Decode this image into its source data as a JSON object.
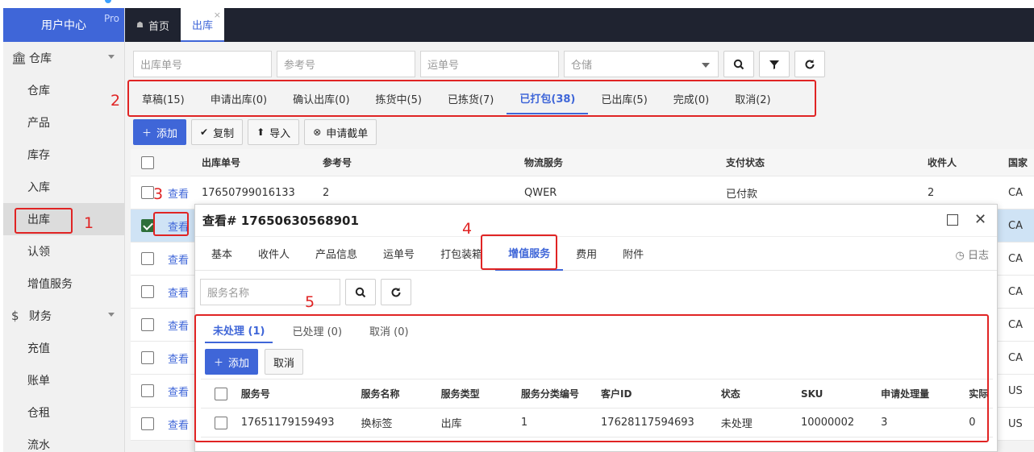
{
  "brand": {
    "title": "用户中心",
    "badge": "Pro"
  },
  "sidebar": {
    "groups": [
      {
        "label": "仓库",
        "icon": "bank-icon",
        "items": [
          "仓库",
          "产品",
          "库存",
          "入库",
          "出库",
          "认领",
          "增值服务"
        ]
      },
      {
        "label": "财务",
        "icon": "dollar-icon",
        "items": [
          "充值",
          "账单",
          "仓租",
          "流水"
        ]
      }
    ],
    "active_item": "出库"
  },
  "page_tabs": [
    {
      "label": "首页",
      "icon": "home-icon"
    },
    {
      "label": "出库",
      "active": true,
      "close": "×"
    }
  ],
  "filters": {
    "outbound_no": "出库单号",
    "reference_no": "参考号",
    "tracking_no": "运单号",
    "warehouse": "仓储",
    "search_icon": "search-icon",
    "filter_icon": "filter-icon",
    "refresh_icon": "refresh-icon"
  },
  "status_tabs": [
    "草稿(15)",
    "申请出库(0)",
    "确认出库(0)",
    "拣货中(5)",
    "已拣货(7)",
    "已打包(38)",
    "已出库(5)",
    "完成(0)",
    "取消(2)"
  ],
  "active_status_tab": "已打包(38)",
  "actions": {
    "add": "添加",
    "copy": "复制",
    "import": "导入",
    "intercept": "申请截单"
  },
  "table": {
    "headers": [
      "出库单号",
      "参考号",
      "物流服务",
      "支付状态",
      "收件人",
      "国家"
    ],
    "view_label": "查看",
    "rows": [
      {
        "no": "17650799016133",
        "ref": "2",
        "logistics": "QWER",
        "pay": "已付款",
        "recipient": "2",
        "country": "CA"
      },
      {
        "country": "CA",
        "selected": true
      },
      {
        "country": "CA"
      },
      {
        "country": "CA"
      },
      {
        "country": "CA"
      },
      {
        "country": "CA"
      },
      {
        "country": "US"
      },
      {
        "country": "US"
      }
    ]
  },
  "modal": {
    "title": "查看# 17650630568901",
    "tabs": [
      "基本",
      "收件人",
      "产品信息",
      "运单号",
      "打包装箱",
      "增值服务",
      "费用",
      "附件"
    ],
    "active_tab": "增值服务",
    "log_label": "日志",
    "search_placeholder": "服务名称",
    "sub_tabs": [
      "未处理 (1)",
      "已处理 (0)",
      "取消 (0)"
    ],
    "active_sub_tab": "未处理 (1)",
    "add_label": "添加",
    "cancel_label": "取消",
    "service_table": {
      "headers": [
        "服务号",
        "服务名称",
        "服务类型",
        "服务分类编号",
        "客户ID",
        "状态",
        "SKU",
        "申请处理量",
        "实际"
      ],
      "rows": [
        {
          "service_no": "17651179159493",
          "name": "换标签",
          "type": "出库",
          "category": "1",
          "customer_id": "17628117594693",
          "status": "未处理",
          "sku": "10000002",
          "qty": "3",
          "actual": "0"
        }
      ]
    }
  },
  "annotations": [
    "1",
    "2",
    "3",
    "4",
    "5"
  ],
  "colors": {
    "accent": "#3f66d8",
    "annotation": "#e02424",
    "tabbar": "#1f2330",
    "selected_row": "#cfe3f5"
  }
}
